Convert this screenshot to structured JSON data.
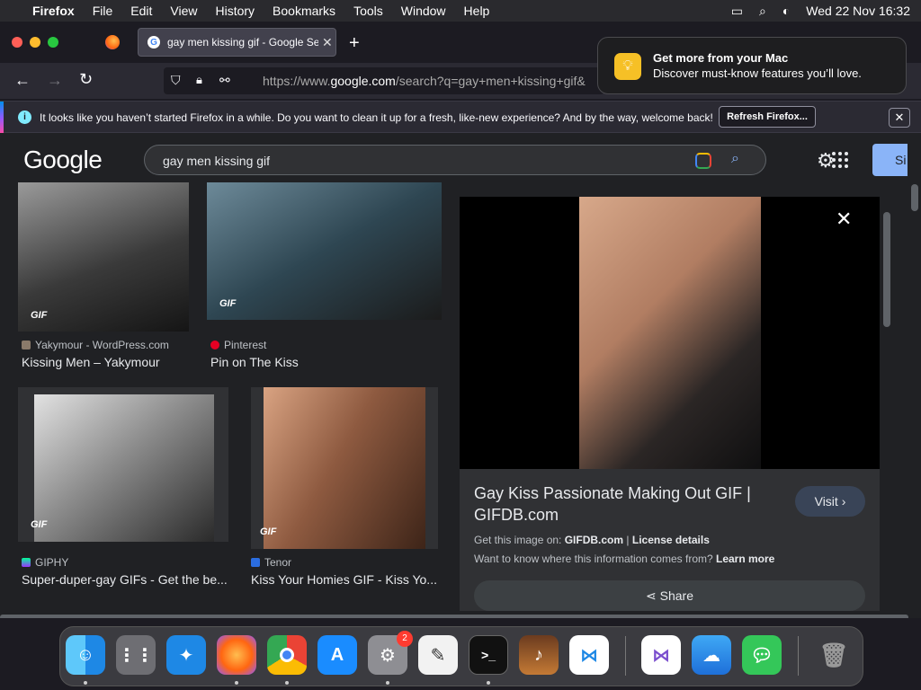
{
  "menubar": {
    "app": "Firefox",
    "items": [
      "File",
      "Edit",
      "View",
      "History",
      "Bookmarks",
      "Tools",
      "Window",
      "Help"
    ],
    "clock": "Wed 22 Nov  16:32"
  },
  "tab": {
    "title": "gay men kissing gif - Google Search"
  },
  "url": {
    "prefix": "https://www.",
    "domain": "google.com",
    "rest": "/search?q=gay+men+kissing+gif&"
  },
  "notification": {
    "message": "It looks like you haven’t started Firefox in a while. Do you want to clean it up for a fresh, like-new experience? And by the way, welcome back!",
    "refresh_label": "Refresh Firefox...",
    "close_label": "✕"
  },
  "mac_popup": {
    "title": "Get more from your Mac",
    "subtitle": "Discover must-know features you’ll love."
  },
  "google": {
    "logo": "Google",
    "query": "gay men kissing gif",
    "signin_label": "Si"
  },
  "results": [
    {
      "badge": "GIF",
      "source": "Yakymour - WordPress.com",
      "title": "Kissing Men – Yakymour"
    },
    {
      "badge": "GIF",
      "source": "Pinterest",
      "title": "Pin on The Kiss"
    },
    {
      "badge": "GIF",
      "source": "GIPHY",
      "title": "Super-duper-gay GIFs - Get the be..."
    },
    {
      "badge": "GIF",
      "source": "Tenor",
      "title": "Kiss Your Homies GIF - Kiss Yo..."
    }
  ],
  "preview": {
    "title": "Gay Kiss Passionate Making Out GIF | GIFDB.com",
    "visit_label": "Visit",
    "get_image_prefix": "Get this image on: ",
    "get_image_site": "GIFDB.com",
    "license": "License details",
    "know_text": "Want to know where this information comes from? ",
    "learn_more": "Learn more",
    "share_label": "Share"
  },
  "dock": {
    "settings_badge": "2"
  },
  "colors": {
    "accent": "#8ab4f8",
    "page_bg": "#202124"
  }
}
